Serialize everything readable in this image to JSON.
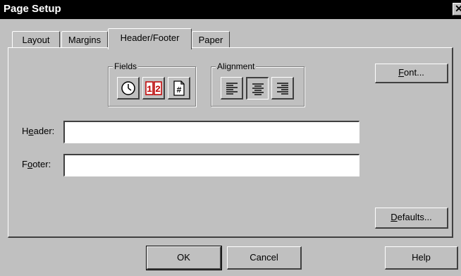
{
  "window": {
    "title": "Page Setup",
    "close_glyph": "✕"
  },
  "tabs": [
    {
      "label": "Layout",
      "active": false
    },
    {
      "label": "Margins",
      "active": false
    },
    {
      "label": "Header/Footer",
      "active": true
    },
    {
      "label": "Paper",
      "active": false
    }
  ],
  "fields_group": {
    "label": "Fields",
    "buttons": [
      {
        "icon": "clock-icon",
        "tooltip": ""
      },
      {
        "icon": "page-number-icon",
        "text": "1"
      },
      {
        "icon": "page-count-icon",
        "text": "#"
      }
    ]
  },
  "alignment_group": {
    "label": "Alignment",
    "selected": "center",
    "buttons": [
      {
        "icon": "align-left-icon"
      },
      {
        "icon": "align-center-icon"
      },
      {
        "icon": "align-right-icon"
      }
    ]
  },
  "font_button": {
    "label_prefix": "",
    "label_accel": "F",
    "label_rest": "ont..."
  },
  "header": {
    "label_prefix": "H",
    "label_accel": "e",
    "label_rest": "ader:",
    "value": ""
  },
  "footer": {
    "label_prefix": "F",
    "label_accel": "o",
    "label_rest": "oter:",
    "value": ""
  },
  "defaults_button": {
    "label_accel": "D",
    "label_rest": "efaults..."
  },
  "ok_button": {
    "label": "OK"
  },
  "cancel_button": {
    "label": "Cancel"
  },
  "help_button": {
    "label": "Help"
  }
}
